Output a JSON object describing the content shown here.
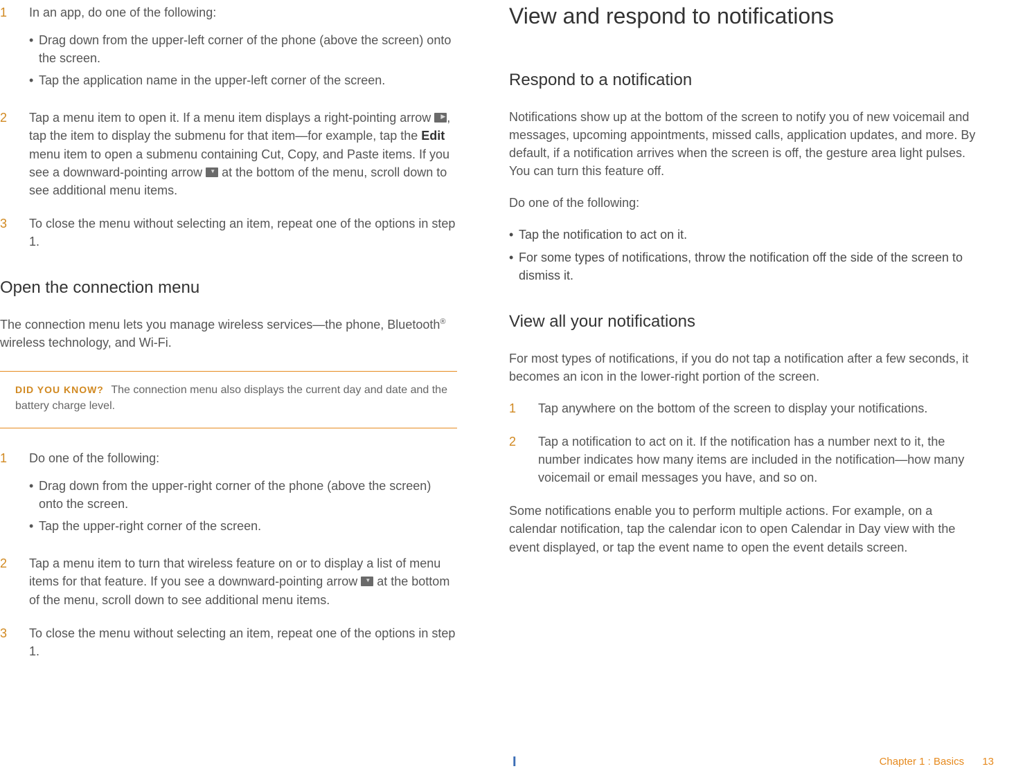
{
  "left": {
    "step1": {
      "num": "1",
      "text": "In an app, do one of the following:",
      "bullets": [
        "Drag down from the upper-left corner of the phone (above the screen) onto the screen.",
        "Tap the application name in the upper-left corner of the screen."
      ]
    },
    "step2": {
      "num": "2",
      "text_a": "Tap a menu item to open it. If a menu item displays a right-pointing arrow ",
      "text_b": ", tap the item to display the submenu for that item—for example, tap the ",
      "edit": "Edit",
      "text_c": " menu item to open a submenu containing Cut, Copy, and Paste items. If you see a downward-pointing arrow ",
      "text_d": " at the bottom of the menu, scroll down to see additional menu items."
    },
    "step3": {
      "num": "3",
      "text": "To close the menu without selecting an item, repeat one of the options in step 1."
    },
    "section_conn": "Open the connection menu",
    "conn_para_a": "The connection menu lets you manage wireless services—the phone, Bluetooth",
    "conn_para_b": " wireless technology, and Wi-Fi.",
    "callout_label": "DID YOU KNOW?",
    "callout_text": "The connection menu also displays the current day and date and the battery charge level.",
    "c_step1": {
      "num": "1",
      "text": "Do one of the following:",
      "bullets": [
        "Drag down from the upper-right corner of the phone (above the screen) onto the screen.",
        "Tap the upper-right corner of the screen."
      ]
    },
    "c_step2": {
      "num": "2",
      "text_a": "Tap a menu item to turn that wireless feature on or to display a list of menu items for that feature. If you see a downward-pointing arrow ",
      "text_b": " at the bottom of the menu, scroll down to see additional menu items."
    },
    "c_step3": {
      "num": "3",
      "text": "To close the menu without selecting an item, repeat one of the options in step 1."
    }
  },
  "right": {
    "title": "View and respond to notifications",
    "respond_h": "Respond to a notification",
    "respond_p1": "Notifications show up at the bottom of the screen to notify you of new voicemail and messages, upcoming appointments, missed calls, application updates, and more. By default, if a notification arrives when the screen is off, the gesture area light pulses. You can turn this feature off.",
    "respond_p2": "Do one of the following:",
    "respond_bullets": [
      "Tap the notification to act on it.",
      "For some types of notifications, throw the notification off the side of the screen to dismiss it."
    ],
    "viewall_h": "View all your notifications",
    "viewall_p1": "For most types of notifications, if you do not tap a notification after a few seconds, it becomes an icon in the lower-right portion of the screen.",
    "v_step1": {
      "num": "1",
      "text": "Tap anywhere on the bottom of the screen to display your notifications."
    },
    "v_step2": {
      "num": "2",
      "text": "Tap a notification to act on it. If the notification has a number next to it, the number indicates how many items are included in the notification—how many voicemail or email messages you have, and so on."
    },
    "viewall_p2": "Some notifications enable you to perform multiple actions. For example, on a calendar notification, tap the calendar icon to open Calendar in Day view with the event displayed, or tap the event name to open the event details screen."
  },
  "footer": {
    "chapter": "Chapter 1 : Basics",
    "page": "13",
    "mark": "I"
  }
}
